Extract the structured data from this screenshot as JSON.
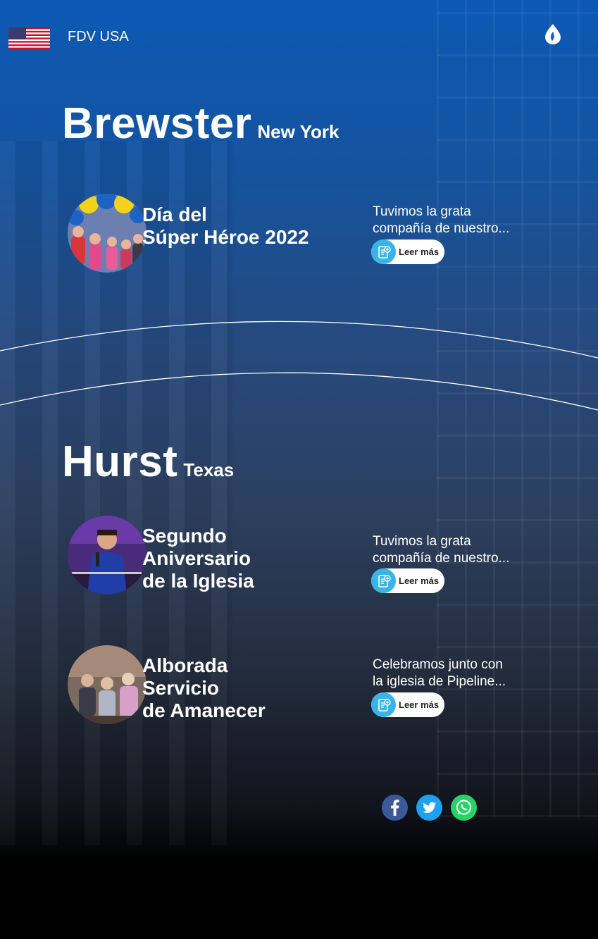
{
  "header": {
    "brand": "FDV USA",
    "flag_icon": "us-flag-icon",
    "logo_icon": "flame-drop-icon"
  },
  "cities": [
    {
      "name": "Brewster",
      "state": "New York",
      "events": [
        {
          "title_lines": [
            "Día del",
            "Súper Héroe 2022"
          ],
          "excerpt_lines": [
            "Tuvimos la grata",
            "compañía de nuestro..."
          ],
          "button": "Leer más"
        }
      ]
    },
    {
      "name": "Hurst",
      "state": "Texas",
      "events": [
        {
          "title_lines": [
            "Segundo",
            "Aniversario",
            "de la Iglesia"
          ],
          "excerpt_lines": [
            "Tuvimos la grata",
            "compañía de nuestro..."
          ],
          "button": "Leer más"
        },
        {
          "title_lines": [
            "Alborada",
            "Servicio",
            "de Amanecer"
          ],
          "excerpt_lines": [
            "Celebramos junto con",
            "la iglesia de Pipeline..."
          ],
          "button": "Leer más"
        }
      ]
    }
  ],
  "social": [
    {
      "icon": "facebook-icon",
      "color": "#3b5998"
    },
    {
      "icon": "twitter-icon",
      "color": "#1da1f2"
    },
    {
      "icon": "whatsapp-icon",
      "color": "#25d366"
    }
  ]
}
